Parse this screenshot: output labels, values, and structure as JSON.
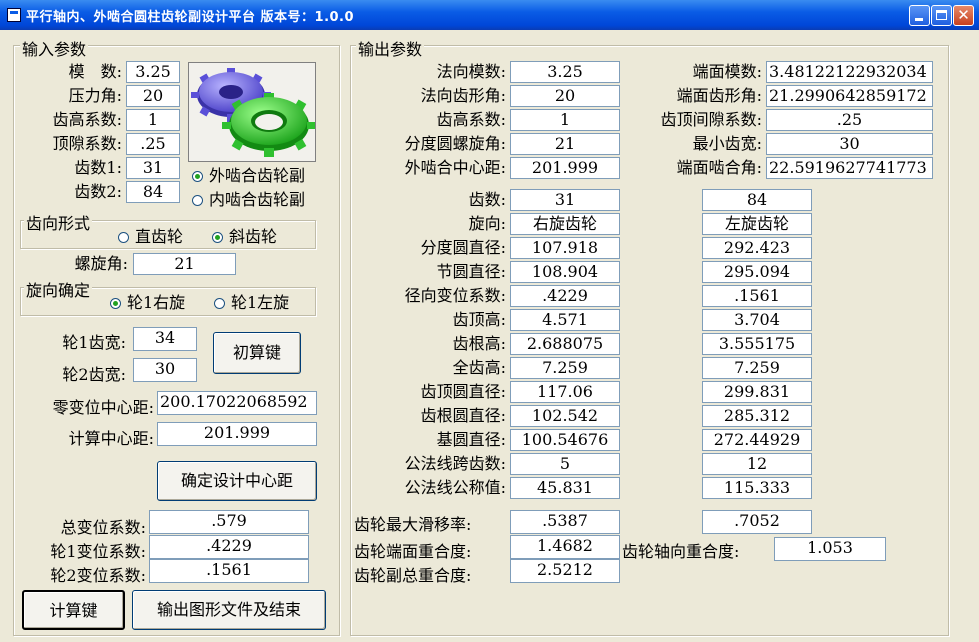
{
  "window": {
    "title": "平行轴内、外啮合圆柱齿轮副设计平台 版本号：1.0.0"
  },
  "input": {
    "group_label": "输入参数",
    "module_label": "模　数:",
    "module_value": "3.25",
    "pressure_angle_label": "压力角:",
    "pressure_angle_value": "20",
    "addendum_coef_label": "齿高系数:",
    "addendum_coef_value": "1",
    "clearance_coef_label": "顶隙系数:",
    "clearance_coef_value": ".25",
    "teeth1_label": "齿数1:",
    "teeth1_value": "31",
    "teeth2_label": "齿数2:",
    "teeth2_value": "84",
    "mesh_external_label": "外啮合齿轮副",
    "mesh_internal_label": "内啮合齿轮副",
    "tooth_form_group_label": "齿向形式",
    "spur_label": "直齿轮",
    "helical_label": "斜齿轮",
    "helix_angle_label": "螺旋角:",
    "helix_angle_value": "21",
    "hand_group_label": "旋向确定",
    "gear1_right_label": "轮1右旋",
    "gear1_left_label": "轮1左旋",
    "width1_label": "轮1齿宽:",
    "width1_value": "34",
    "width2_label": "轮2齿宽:",
    "width2_value": "30",
    "initial_calc_button": "初算键",
    "zero_shift_center_label": "零变位中心距:",
    "zero_shift_center_value": "200.17022068592",
    "calc_center_label": "计算中心距:",
    "calc_center_value": "201.999",
    "confirm_center_button": "确定设计中心距",
    "total_shift_label": "总变位系数:",
    "total_shift_value": ".579",
    "shift1_label": "轮1变位系数:",
    "shift1_value": ".4229",
    "shift2_label": "轮2变位系数:",
    "shift2_value": ".1561",
    "calc_button": "计算键",
    "export_button": "输出图形文件及结束"
  },
  "output": {
    "group_label": "输出参数",
    "normal_module_label": "法向模数:",
    "normal_module_value": "3.25",
    "normal_pressure_label": "法向齿形角:",
    "normal_pressure_value": "20",
    "addendum_coef_label": "齿高系数:",
    "addendum_coef_value": "1",
    "helix_label": "分度圆螺旋角:",
    "helix_value": "21",
    "center_label": "外啮合中心距:",
    "center_value": "201.999",
    "transverse_module_label": "端面模数:",
    "transverse_module_value": "3.48122122932034",
    "transverse_pressure_label": "端面齿形角:",
    "transverse_pressure_value": "21.2990642859172",
    "tip_clearance_label": "齿顶间隙系数:",
    "tip_clearance_value": ".25",
    "min_width_label": "最小齿宽:",
    "min_width_value": "30",
    "working_angle_label": "端面啮合角:",
    "working_angle_value": "22.5919627741773",
    "rows": [
      {
        "label": "齿数:",
        "g1": "31",
        "g2": "84"
      },
      {
        "label": "旋向:",
        "g1": "右旋齿轮",
        "g2": "左旋齿轮"
      },
      {
        "label": "分度圆直径:",
        "g1": "107.918",
        "g2": "292.423"
      },
      {
        "label": "节圆直径:",
        "g1": "108.904",
        "g2": "295.094"
      },
      {
        "label": "径向变位系数:",
        "g1": ".4229",
        "g2": ".1561"
      },
      {
        "label": "齿顶高:",
        "g1": "4.571",
        "g2": "3.704"
      },
      {
        "label": "齿根高:",
        "g1": "2.688075",
        "g2": "3.555175"
      },
      {
        "label": "全齿高:",
        "g1": "7.259",
        "g2": "7.259"
      },
      {
        "label": "齿顶圆直径:",
        "g1": "117.06",
        "g2": "299.831"
      },
      {
        "label": "齿根圆直径:",
        "g1": "102.542",
        "g2": "285.312"
      },
      {
        "label": "基圆直径:",
        "g1": "100.54676",
        "g2": "272.44929"
      },
      {
        "label": "公法线跨齿数:",
        "g1": "5",
        "g2": "12"
      },
      {
        "label": "公法线公称值:",
        "g1": "45.831",
        "g2": "115.333"
      }
    ],
    "max_slip_label": "齿轮最大滑移率:",
    "max_slip_g1": ".5387",
    "max_slip_g2": ".7052",
    "transverse_contact_label": "齿轮端面重合度:",
    "transverse_contact_value": "1.4682",
    "axial_contact_label": "齿轮轴向重合度:",
    "axial_contact_value": "1.053",
    "total_contact_label": "齿轮副总重合度:",
    "total_contact_value": "2.5212"
  }
}
